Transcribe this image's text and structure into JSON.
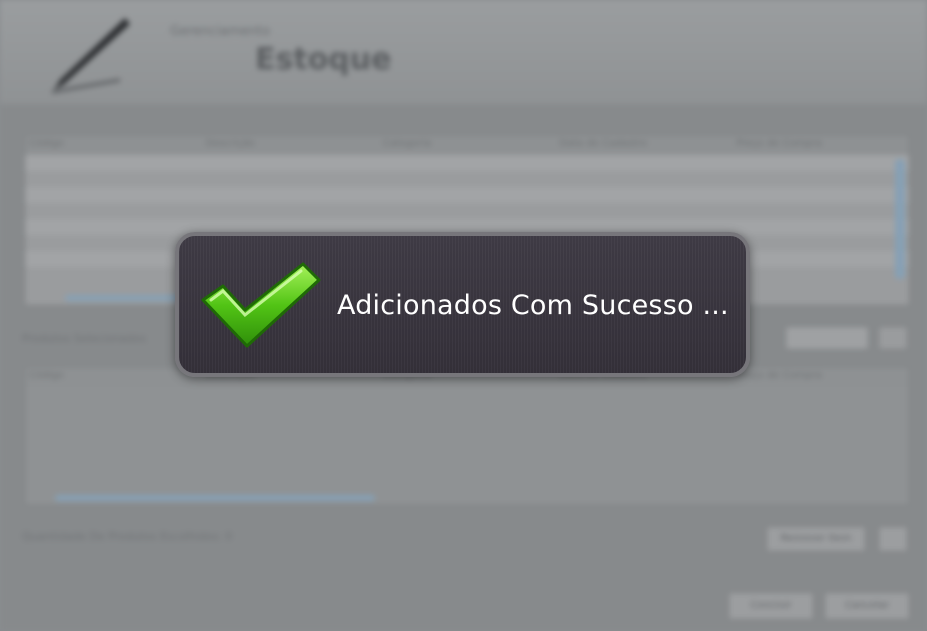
{
  "app": {
    "subtitle": "Gerenciamento",
    "title": "Estoque",
    "accent_color": "#5ac21a",
    "pen_icon": "pen-icon"
  },
  "table": {
    "columns": [
      "Código",
      "Descrição",
      "Categoria",
      "Data do Cadastro",
      "Preço de Compra"
    ]
  },
  "labels": {
    "selected_products": "Produtos Selecionados",
    "count": "Quantidade De Produtos Escolhidos: 0",
    "remove_button": "Remover Item",
    "confirm_button": "Concluir",
    "cancel_button": "Cancelar"
  },
  "toast": {
    "icon": "checkmark-icon",
    "message": "Adicionados Com Sucesso ..."
  }
}
